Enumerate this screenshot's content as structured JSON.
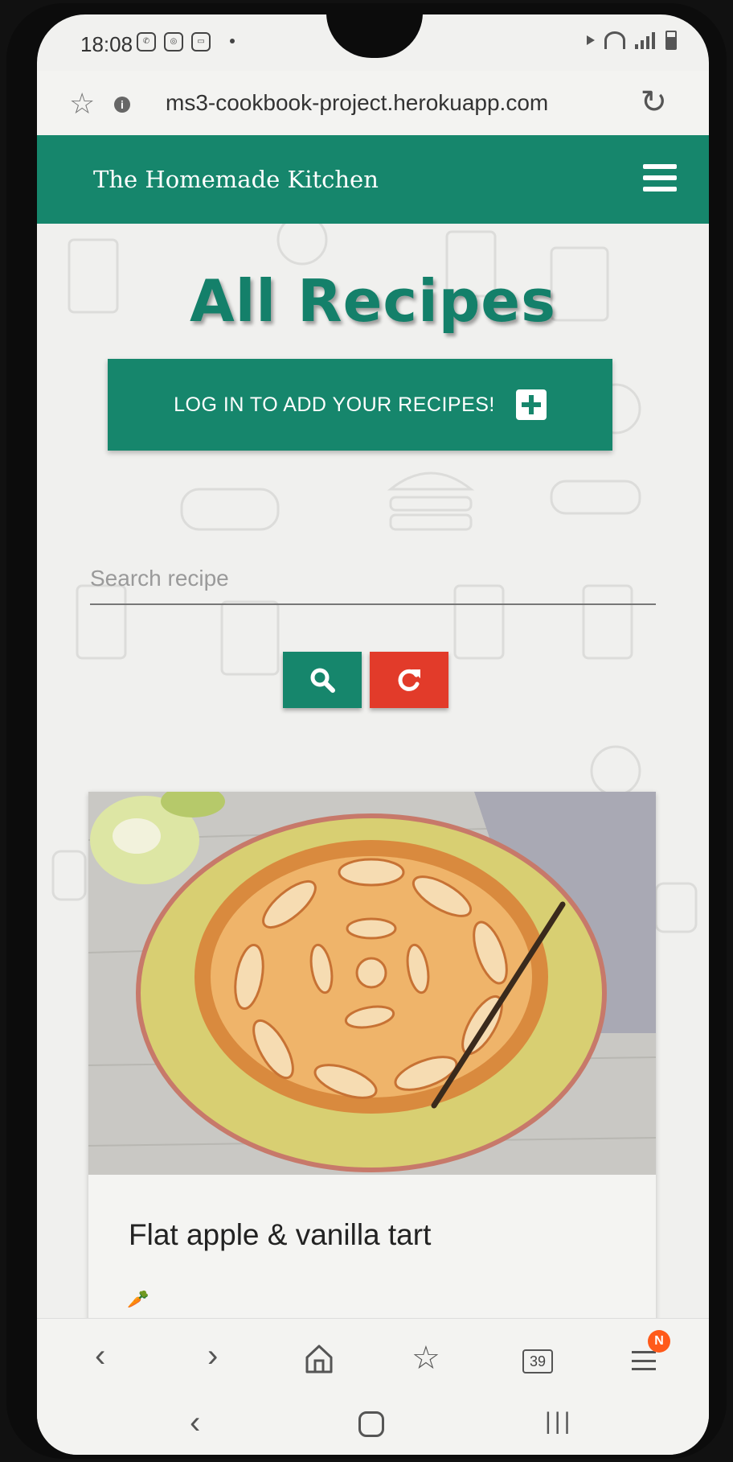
{
  "status_bar": {
    "time": "18:08",
    "left_icons": [
      "whatsapp-icon",
      "instagram-icon",
      "ring-app-icon"
    ],
    "right_icons": [
      "mute-icon",
      "wifi-icon",
      "signal-icon",
      "battery-icon"
    ]
  },
  "browser": {
    "url": "ms3-cookbook-project.herokuapp.com",
    "tab_count": "39",
    "notification_badge": "N"
  },
  "site": {
    "brand": "The Homemade Kitchen"
  },
  "page": {
    "title": "All Recipes",
    "login_button": "LOG IN TO ADD YOUR RECIPES!",
    "search_placeholder": "Search recipe"
  },
  "recipes": [
    {
      "title": "Flat apple & vanilla tart",
      "diet_icon": "carrot-icon"
    }
  ],
  "colors": {
    "primary": "#16866c",
    "danger": "#e23b2a",
    "badge": "#ff5a1a"
  }
}
